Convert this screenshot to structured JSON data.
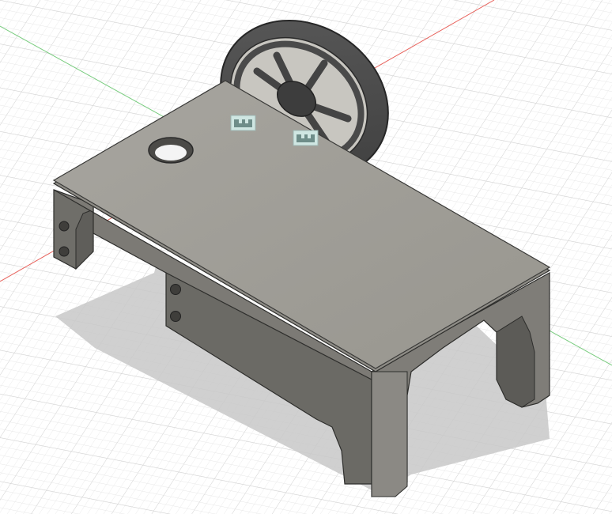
{
  "viewport": {
    "background_color": "#ffffff",
    "grid_minor_color": "#e3e3e3",
    "grid_major_color": "#cfcfcf",
    "axis_x_color": "#e8605a",
    "axis_y_color": "#78cc7e",
    "model_colors": {
      "top_face": "#a09e98",
      "side_dark": "#6f6e69",
      "side_mid": "#84827c",
      "wheel": "#4f4f4f",
      "wheel_dark": "#3a3a3a",
      "edge": "#2e2e2c",
      "shadow": "#c9c9c9"
    },
    "icons": [
      "joint-icon",
      "joint-icon"
    ]
  }
}
